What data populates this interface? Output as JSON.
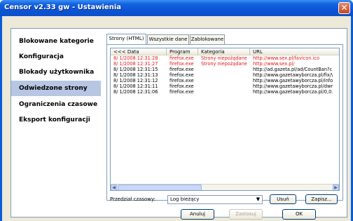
{
  "window": {
    "title": "Censor v2.33 gw - Ustawienia"
  },
  "sidebar": {
    "items": [
      {
        "label": "Blokowane kategorie"
      },
      {
        "label": "Konfiguracja"
      },
      {
        "label": "Blokady użytkownika"
      },
      {
        "label": "Odwiedzone strony"
      },
      {
        "label": "Ograniczenia czasowe"
      },
      {
        "label": "Eksport konfiguracji"
      }
    ],
    "active_index": 3
  },
  "tabs": [
    {
      "label": "Strony (HTML)"
    },
    {
      "label": "Wszystkie dane"
    },
    {
      "label": "Zablokowane"
    }
  ],
  "table": {
    "columns": [
      "<<< Data",
      "Program",
      "Kategoria",
      "URL"
    ],
    "rows": [
      {
        "date": "8/ 1/2008 12:31:28",
        "program": "firefox.exe",
        "category": "Strony niepożądane",
        "url": "http://www.sex.pl/favicon.ico",
        "blocked": true
      },
      {
        "date": "8/ 1/2008 12:31:27",
        "program": "firefox.exe",
        "category": "Strony niepożądane",
        "url": "http://www.sex.pl/",
        "blocked": true
      },
      {
        "date": "8/ 1/2008 12:31:15",
        "program": "firefox.exe",
        "category": "",
        "url": "http://ad.gazeta.pl/ad/CountBan?c",
        "blocked": false
      },
      {
        "date": "8/ 1/2008 12:31:13",
        "program": "firefox.exe",
        "category": "",
        "url": "http://www.gazetawyborcza.pl/fix/\\",
        "blocked": false
      },
      {
        "date": "8/ 1/2008 12:31:12",
        "program": "firefox.exe",
        "category": "",
        "url": "http://www.gazetawyborcza.pl/info",
        "blocked": false
      },
      {
        "date": "8/ 1/2008 12:31:11",
        "program": "firefox.exe",
        "category": "",
        "url": "http://www.gazetawyborcza.pl/dwr",
        "blocked": false
      },
      {
        "date": "8/ 1/2008 12:31:06",
        "program": "firefox.exe",
        "category": "",
        "url": "http://www.gazetawyborcza.pl/0,0.",
        "blocked": false
      }
    ]
  },
  "filters": {
    "range_label": "Przedział czasowy:",
    "range_value": "Log bieżący",
    "delete_label": "Usuń",
    "save_label": "Zapisz..."
  },
  "footer": {
    "cancel_label": "Anuluj",
    "apply_label": "Zastosuj",
    "ok_label": "OK"
  },
  "colors": {
    "blocked_text": "#e01818",
    "active_nav": "#b7c6e3",
    "title_bar": "#0b55d6"
  }
}
